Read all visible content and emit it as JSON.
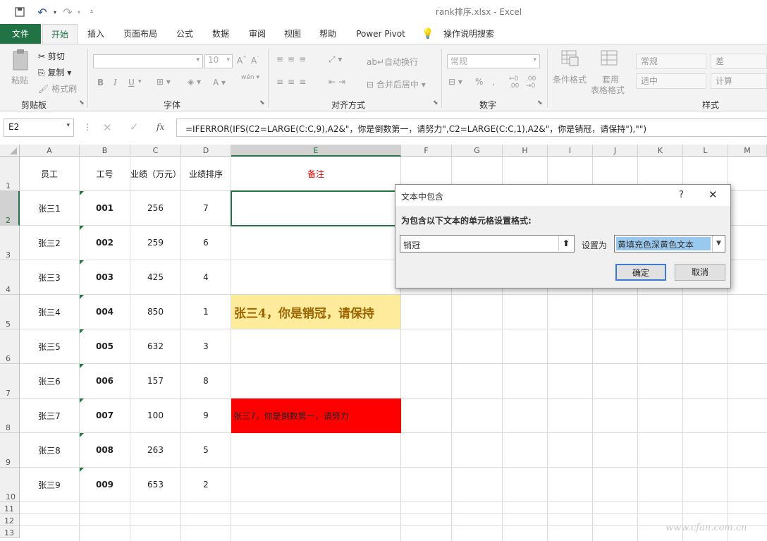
{
  "window": {
    "title": "rank排序.xlsx  -  Excel"
  },
  "tabs": [
    "文件",
    "开始",
    "插入",
    "页面布局",
    "公式",
    "数据",
    "审阅",
    "视图",
    "帮助",
    "Power Pivot"
  ],
  "search_label": "操作说明搜索",
  "ribbon": {
    "clipboard": {
      "paste": "粘贴",
      "cut": "剪切",
      "copy": "复制",
      "format_painter": "格式刷",
      "label": "剪贴板"
    },
    "font": {
      "size": "10",
      "label": "字体",
      "bold": "B",
      "italic": "I",
      "underline": "U",
      "font_color": "A",
      "wen": "wén"
    },
    "alignment": {
      "wrap": "自动换行",
      "merge": "合并后居中",
      "label": "对齐方式"
    },
    "number": {
      "format": "常规",
      "percent": "%",
      "label": "数字"
    },
    "cond_format": {
      "line1": "条件格式",
      "line2": ""
    },
    "table_format": {
      "line1": "套用",
      "line2": "表格格式"
    },
    "styles": {
      "normal": "常规",
      "bad": "差",
      "neutral": "适中",
      "calc": "计算",
      "label": "样式"
    }
  },
  "formula_bar": {
    "name_box": "E2",
    "fx": "fx",
    "formula": "=IFERROR(IFS(C2=LARGE(C:C,9),A2&\"，你是倒数第一，请努力\",C2=LARGE(C:C,1),A2&\"，你是销冠，请保持\"),\"\")"
  },
  "columns": [
    "A",
    "B",
    "C",
    "D",
    "E",
    "F",
    "G",
    "H",
    "I",
    "J",
    "K",
    "L",
    "M"
  ],
  "rows": [
    "1",
    "2",
    "3",
    "4",
    "5",
    "6",
    "7",
    "8",
    "9",
    "10",
    "11",
    "12",
    "13"
  ],
  "headers": {
    "a": "员工",
    "b": "工号",
    "c": "业绩（万元）",
    "d": "业绩排序",
    "e": "备注"
  },
  "data_rows": [
    {
      "name": "张三1",
      "id": "001",
      "perf": "256",
      "rank": "7",
      "note": ""
    },
    {
      "name": "张三2",
      "id": "002",
      "perf": "259",
      "rank": "6",
      "note": ""
    },
    {
      "name": "张三3",
      "id": "003",
      "perf": "425",
      "rank": "4",
      "note": ""
    },
    {
      "name": "张三4",
      "id": "004",
      "perf": "850",
      "rank": "1",
      "note": "张三4，你是销冠，请保持"
    },
    {
      "name": "张三5",
      "id": "005",
      "perf": "632",
      "rank": "3",
      "note": ""
    },
    {
      "name": "张三6",
      "id": "006",
      "perf": "157",
      "rank": "8",
      "note": ""
    },
    {
      "name": "张三7",
      "id": "007",
      "perf": "100",
      "rank": "9",
      "note": "张三7，你是倒数第一，请努力"
    },
    {
      "name": "张三8",
      "id": "008",
      "perf": "263",
      "rank": "5",
      "note": ""
    },
    {
      "name": "张三9",
      "id": "009",
      "perf": "653",
      "rank": "2",
      "note": ""
    }
  ],
  "dialog": {
    "title": "文本中包含",
    "help": "?",
    "close": "✕",
    "prompt": "为包含以下文本的单元格设置格式:",
    "text_value": "销冠",
    "set_as_label": "设置为",
    "format_option": "黄填充色深黄色文本",
    "ok": "确定",
    "cancel": "取消"
  },
  "colors": {
    "excel_green": "#217346",
    "yellow_fill": "#ffeb9c",
    "dark_yellow_text": "#9c6500",
    "red_fill": "#ff0000",
    "selected_option": "#99c9ef"
  },
  "watermark": "www.cfan.com.cn"
}
